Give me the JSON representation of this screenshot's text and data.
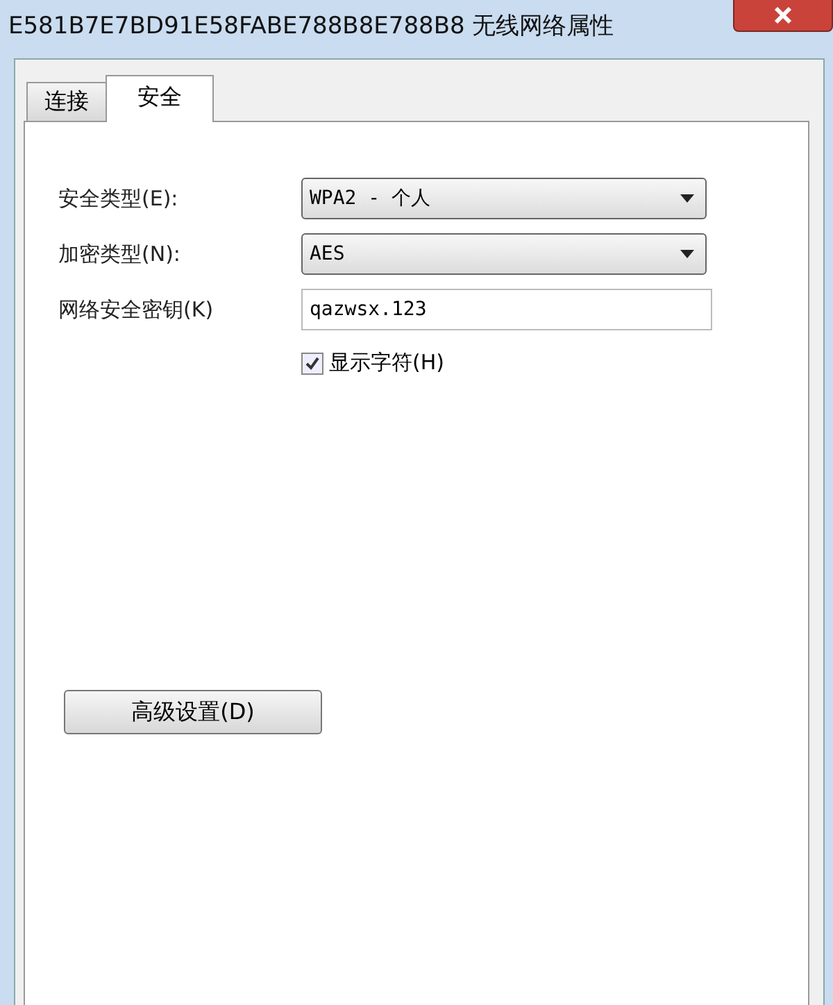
{
  "window": {
    "title": "E581B7E7BD91E58FABE788B8E788B8 无线网络属性"
  },
  "tabs": [
    {
      "label": "连接",
      "selected": false
    },
    {
      "label": "安全",
      "selected": true
    }
  ],
  "fields": [
    {
      "kind": "dropdown",
      "label": "安全类型(E):",
      "value": "WPA2 - 个人"
    },
    {
      "kind": "dropdown",
      "label": "加密类型(N):",
      "value": "AES"
    },
    {
      "kind": "text",
      "label": "网络安全密钥(K)",
      "value": "qazwsx.123"
    }
  ],
  "show_characters": {
    "label": "显示字符(H)",
    "checked": true
  },
  "advanced_button": "高级设置(D)"
}
